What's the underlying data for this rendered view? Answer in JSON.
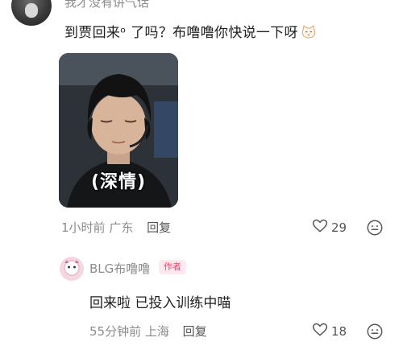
{
  "comment": {
    "username": "我才没有讲气话",
    "text": "到贾回来ᵒ 了吗？布噜噜你快说一下呀",
    "emoji_icon": "cat-face-emoji-icon",
    "image_caption": "(深情)",
    "time": "1小时前",
    "location": "广东",
    "reply_label": "回复",
    "likes": "29"
  },
  "reply": {
    "username": "BLG布噜噜",
    "badge": "作者",
    "text": "回来啦 已投入训练中喵",
    "time": "55分钟前",
    "location": "上海",
    "reply_label": "回复",
    "likes": "18"
  },
  "icons": {
    "like": "heart-outline-icon",
    "more": "emoji-smile-icon"
  },
  "colors": {
    "badge_text": "#ff3b6a",
    "badge_bg": "#ffe8ee",
    "meta_text": "#8c8c8c"
  }
}
